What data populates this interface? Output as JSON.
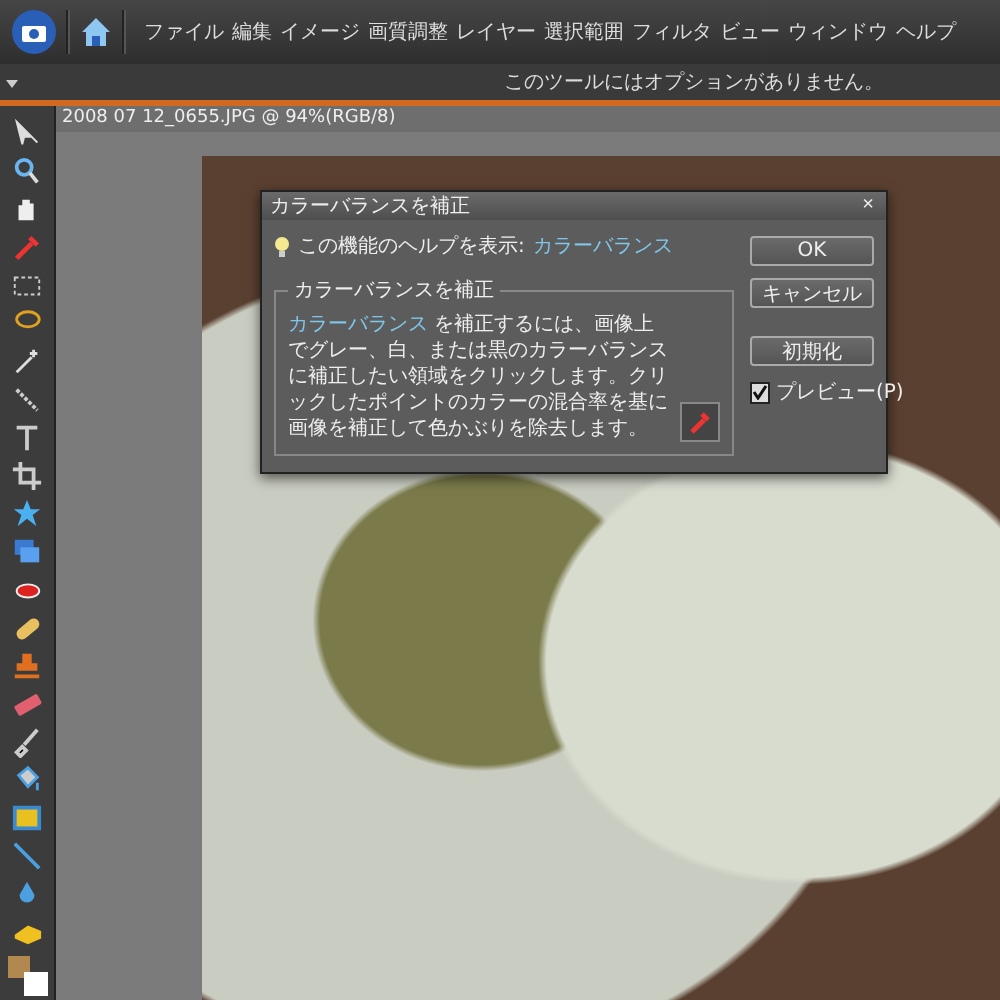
{
  "menu_bar": {
    "items": [
      "ファイル",
      "編集",
      "イメージ",
      "画質調整",
      "レイヤー",
      "選択範囲",
      "フィルタ",
      "ビュー",
      "ウィンドウ",
      "ヘルプ"
    ]
  },
  "options_bar": {
    "message": "このツールにはオプションがありません。"
  },
  "document": {
    "title": "2008 07 12_0655.JPG @ 94%(RGB/8)"
  },
  "dialog": {
    "title": "カラーバランスを補正",
    "close": "×",
    "help_label": "この機能のヘルプを表示:",
    "help_link": "カラーバランス",
    "group_title": "カラーバランスを補正",
    "body_link": "カラーバランス",
    "body_text": " を補正するには、画像上でグレー、白、または黒のカラーバランスに補正したい領域をクリックします。クリックしたポイントのカラーの混合率を基に画像を補正して色かぶりを除去します。",
    "buttons": [
      "OK",
      "キャンセル",
      "初期化"
    ],
    "preview": {
      "label": "プレビュー(P)",
      "checked": true
    }
  }
}
